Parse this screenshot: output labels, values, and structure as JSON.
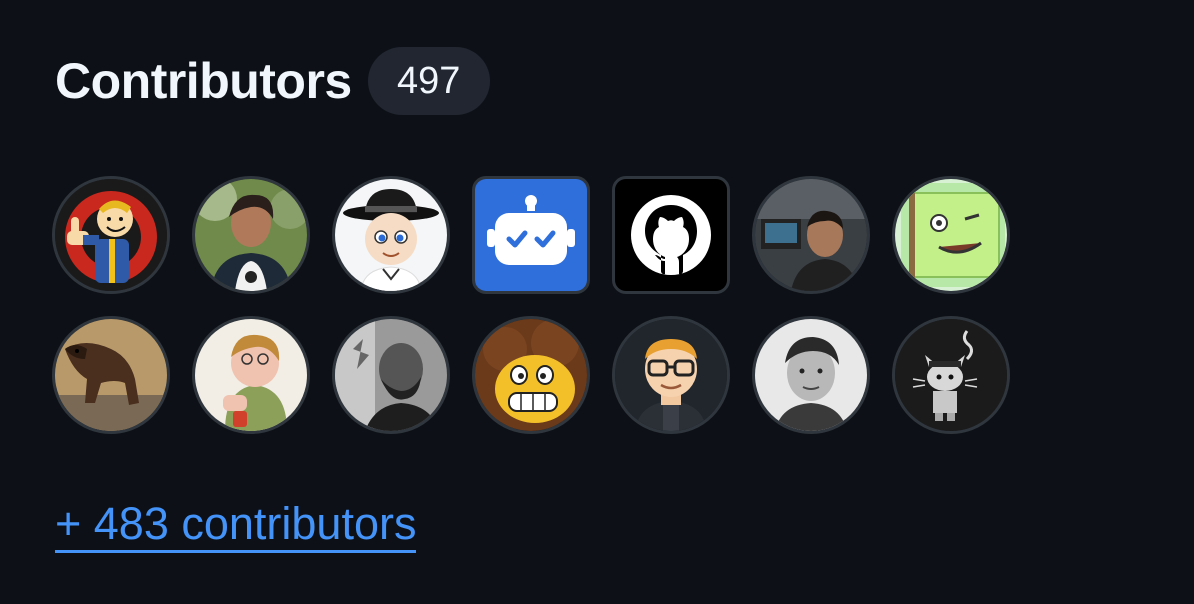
{
  "header": {
    "title": "Contributors",
    "count": "497"
  },
  "avatars": [
    {
      "name": "avatar-vault-boy",
      "shape": "circle",
      "icon": "vault-boy-thumbs-up"
    },
    {
      "name": "avatar-person-outdoors",
      "shape": "circle",
      "icon": "person-photo"
    },
    {
      "name": "avatar-cartoon-hat-man",
      "shape": "circle",
      "icon": "cartoon-man-hat"
    },
    {
      "name": "avatar-bot",
      "shape": "square",
      "icon": "robot-icon",
      "color": "#2f6fdb"
    },
    {
      "name": "avatar-github",
      "shape": "square",
      "icon": "github-octocat-icon",
      "color": "#000000"
    },
    {
      "name": "avatar-person-desk",
      "shape": "circle",
      "icon": "person-photo"
    },
    {
      "name": "avatar-green-block",
      "shape": "circle",
      "icon": "green-block-face",
      "color": "#c4f08a"
    },
    {
      "name": "avatar-horse",
      "shape": "circle",
      "icon": "horse-photo"
    },
    {
      "name": "avatar-cartoon-eating",
      "shape": "circle",
      "icon": "cartoon-person-eating"
    },
    {
      "name": "avatar-bw-man",
      "shape": "circle",
      "icon": "person-photo-bw"
    },
    {
      "name": "avatar-cartoon-grin",
      "shape": "circle",
      "icon": "cartoon-grinning-face"
    },
    {
      "name": "avatar-glasses-man",
      "shape": "circle",
      "icon": "cartoon-man-glasses"
    },
    {
      "name": "avatar-young-man",
      "shape": "circle",
      "icon": "person-photo-bw"
    },
    {
      "name": "avatar-dark-cat",
      "shape": "circle",
      "icon": "cat-illustration"
    }
  ],
  "footer": {
    "more_link": "+ 483 contributors"
  },
  "colors": {
    "background": "#0d1117",
    "text": "#f0f6fc",
    "counter_bg": "#212630",
    "link": "#4493f8",
    "avatar_border": "#30363d"
  }
}
